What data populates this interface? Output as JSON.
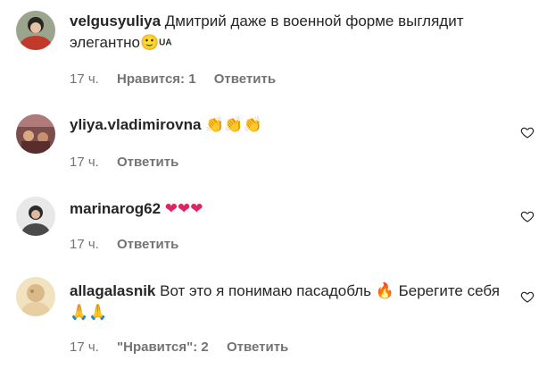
{
  "comments": [
    {
      "username": "velgusyuliya",
      "text": "Дмитрий даже в военной форме выглядит элегантно",
      "emoji_tail": "🙂",
      "badge": "UA",
      "time": "17 ч.",
      "likes": "Нравится: 1",
      "reply": "Ответить",
      "heart_icon": "heart-outline-icon"
    },
    {
      "username": "yliya.vladimirovna",
      "text": "",
      "emoji_tail": "👏👏👏",
      "time": "17 ч.",
      "reply": "Ответить",
      "heart_icon": "heart-outline-icon"
    },
    {
      "username": "marinarog62",
      "text": "",
      "emoji_tail": "❤❤❤",
      "time": "17 ч.",
      "reply": "Ответить",
      "heart_icon": "heart-outline-icon"
    },
    {
      "username": "allagalasnik",
      "text": "Вот это я понимаю пасадобль",
      "emoji_mid": "🔥",
      "text2": "Берегите себя",
      "emoji_tail": "🙏🙏",
      "time": "17 ч.",
      "likes": "\"Нравится\": 2",
      "reply": "Ответить",
      "heart_icon": "heart-outline-icon"
    }
  ]
}
